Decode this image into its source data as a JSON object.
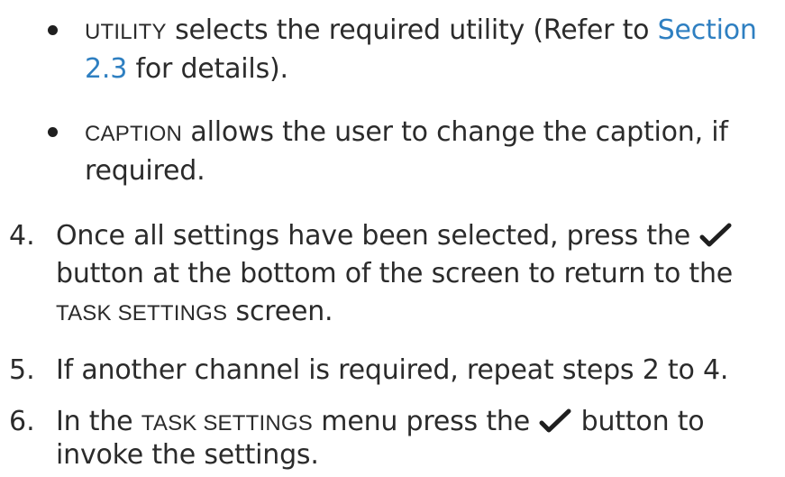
{
  "bullets": [
    {
      "keyword": "UTILITY",
      "line1_text": " selects the required utility (Refer to ",
      "line1_link": "Section",
      "line2_link": "2.3",
      "line2_text": " for details)."
    },
    {
      "keyword": "CAPTION",
      "line1_text": " allows the user to change the caption, if",
      "line2_text": "required."
    }
  ],
  "steps": [
    {
      "number": "4.",
      "line1_text": "Once all settings have been selected, press the",
      "line2_text": "button at the bottom of the screen to return to the",
      "line3_keyword": "TASK SETTINGS",
      "line3_text": " screen."
    },
    {
      "number": "5.",
      "line1_text": "If another channel is required, repeat steps 2 to 4."
    },
    {
      "number": "6.",
      "line1_text_a": "In the ",
      "line1_keyword": "TASK SETTINGS",
      "line1_text_b": " menu press the",
      "line1_text_c": " button to",
      "line2_text": "invoke the settings."
    }
  ],
  "icons": {
    "confirm": "checkmark-icon",
    "color": "#1f1f1f"
  },
  "colors": {
    "text": "#2b2b2b",
    "link": "#2e7fc1"
  }
}
